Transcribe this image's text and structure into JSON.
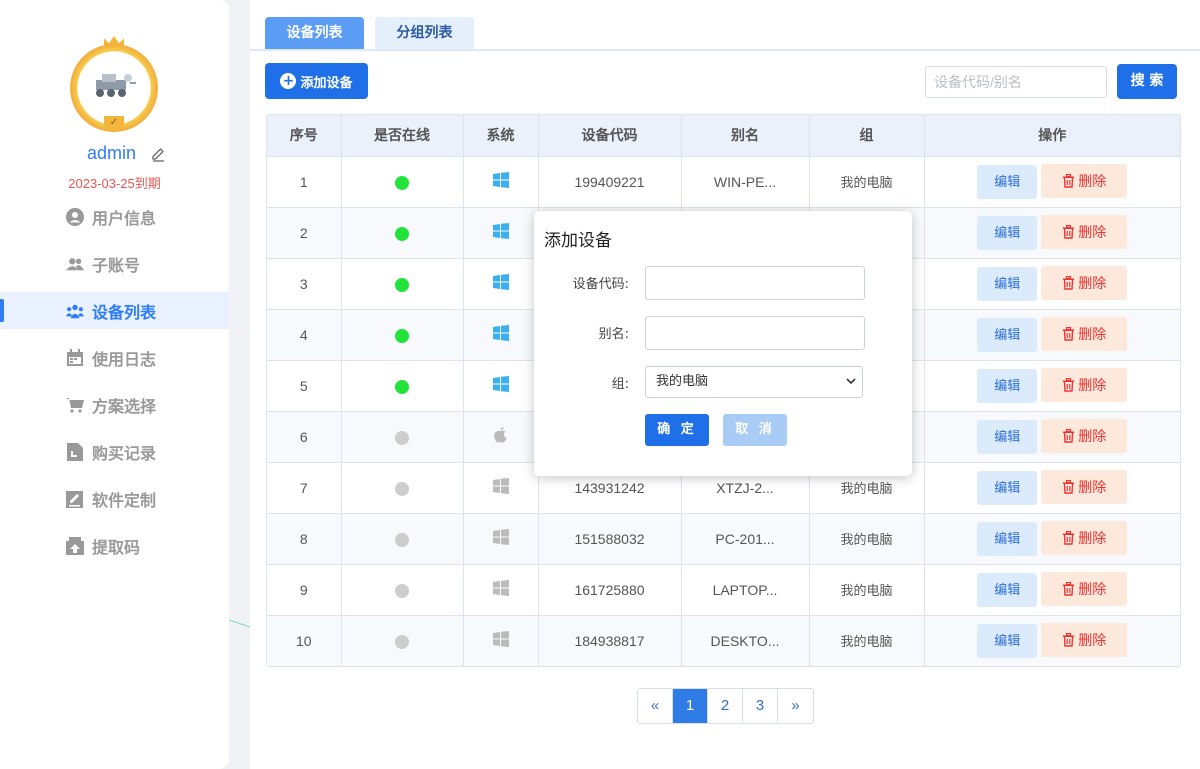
{
  "user": {
    "name": "admin",
    "expiry": "2023-03-25到期"
  },
  "sidebar": {
    "items": [
      {
        "label": "用户信息",
        "icon": "user-circle-icon"
      },
      {
        "label": "子账号",
        "icon": "users-icon"
      },
      {
        "label": "设备列表",
        "icon": "user-group-icon",
        "active": true
      },
      {
        "label": "使用日志",
        "icon": "calendar-icon"
      },
      {
        "label": "方案选择",
        "icon": "cart-icon"
      },
      {
        "label": "购买记录",
        "icon": "file-icon"
      },
      {
        "label": "软件定制",
        "icon": "edit-icon"
      },
      {
        "label": "提取码",
        "icon": "upload-box-icon"
      }
    ]
  },
  "tabs": [
    {
      "label": "设备列表",
      "active": true
    },
    {
      "label": "分组列表",
      "active": false
    }
  ],
  "toolbar": {
    "add_label": "添加设备",
    "search_placeholder": "设备代码/别名",
    "search_label": "搜 索"
  },
  "table": {
    "headers": [
      "序号",
      "是否在线",
      "系统",
      "设备代码",
      "别名",
      "组",
      "操作"
    ],
    "edit_label": "编辑",
    "delete_label": "删除",
    "rows": [
      {
        "no": "1",
        "online": true,
        "os": "windows",
        "code": "199409221",
        "alias": "WIN-PE...",
        "group": "我的电脑"
      },
      {
        "no": "2",
        "online": true,
        "os": "windows",
        "code": "",
        "alias": "",
        "group": ""
      },
      {
        "no": "3",
        "online": true,
        "os": "windows",
        "code": "",
        "alias": "",
        "group": ""
      },
      {
        "no": "4",
        "online": true,
        "os": "windows",
        "code": "",
        "alias": "",
        "group": ""
      },
      {
        "no": "5",
        "online": true,
        "os": "windows",
        "code": "",
        "alias": "",
        "group": ""
      },
      {
        "no": "6",
        "online": false,
        "os": "apple",
        "code": "",
        "alias": "",
        "group": ""
      },
      {
        "no": "7",
        "online": false,
        "os": "windows",
        "code": "143931242",
        "alias": "XTZJ-2...",
        "group": "我的电脑"
      },
      {
        "no": "8",
        "online": false,
        "os": "windows",
        "code": "151588032",
        "alias": "PC-201...",
        "group": "我的电脑"
      },
      {
        "no": "9",
        "online": false,
        "os": "windows",
        "code": "161725880",
        "alias": "LAPTOP...",
        "group": "我的电脑"
      },
      {
        "no": "10",
        "online": false,
        "os": "windows",
        "code": "184938817",
        "alias": "DESKTO...",
        "group": "我的电脑"
      }
    ]
  },
  "pagination": {
    "prev": "«",
    "pages": [
      "1",
      "2",
      "3"
    ],
    "current": "1",
    "next": "»"
  },
  "modal": {
    "title": "添加设备",
    "code_label": "设备代码:",
    "alias_label": "别名:",
    "group_label": "组:",
    "group_value": "我的电脑",
    "ok_label": "确 定",
    "cancel_label": "取 消"
  },
  "colors": {
    "accent": "#1e6fe8",
    "online": "#22e33a",
    "offline": "#cdcdcd",
    "danger": "#e33333",
    "windows": "#3ab0f2"
  }
}
